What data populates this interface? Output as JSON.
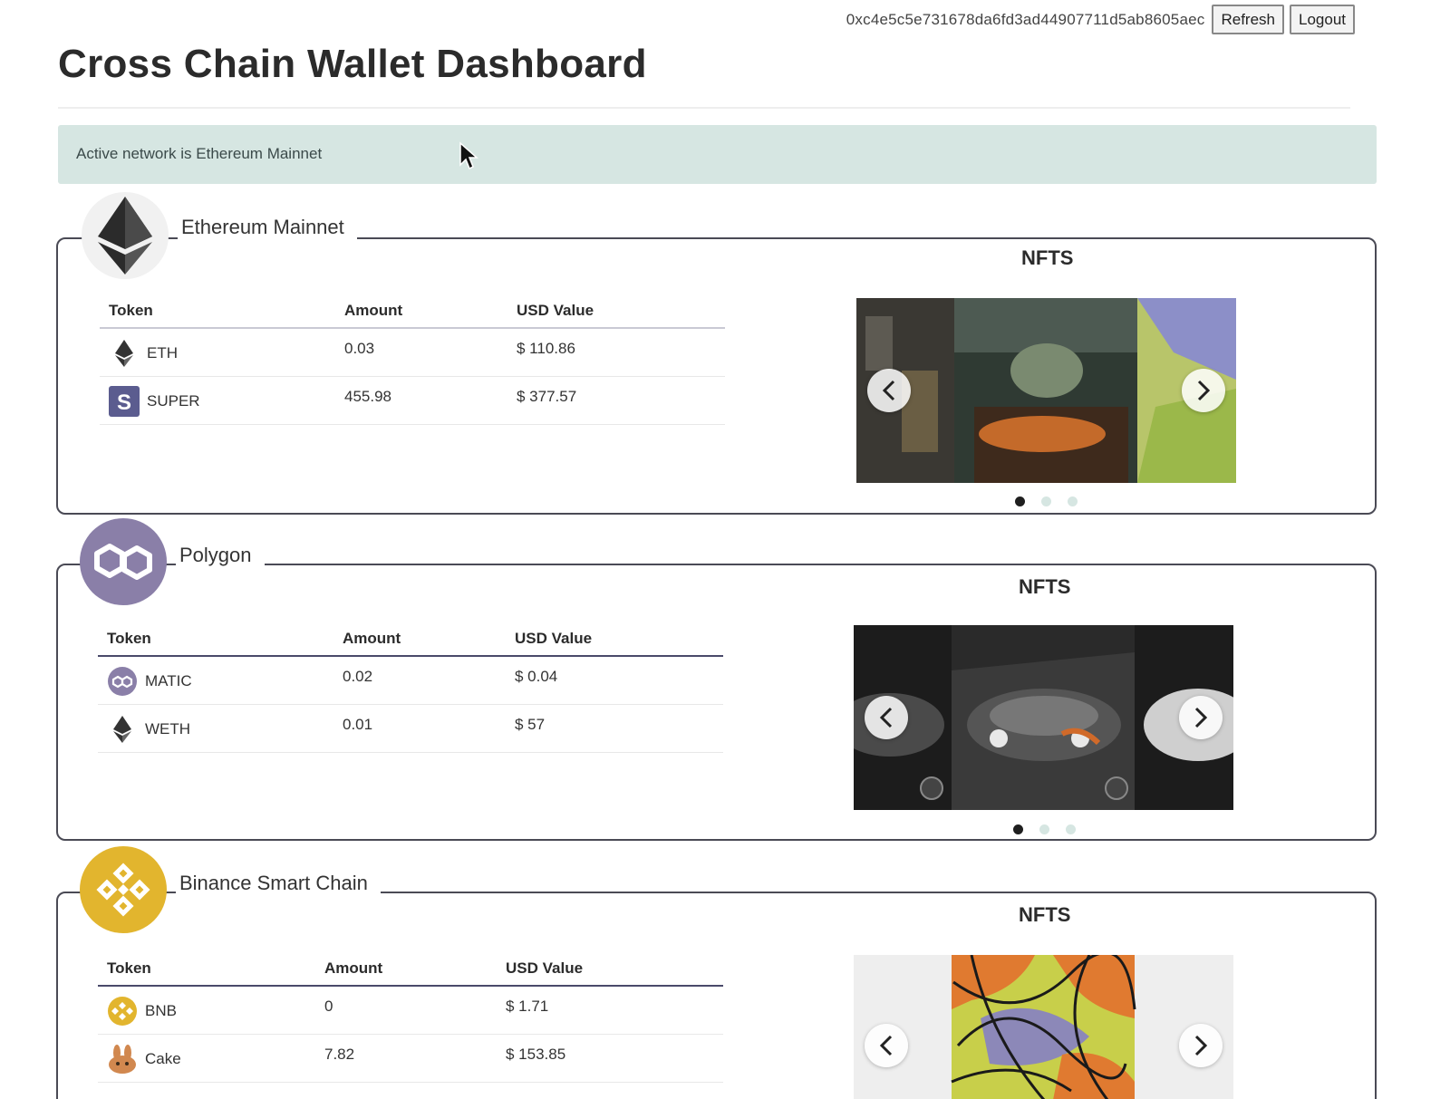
{
  "header": {
    "address": "0xc4e5c5e731678da6fd3ad44907711d5ab8605aec",
    "refresh_label": "Refresh",
    "logout_label": "Logout",
    "title": "Cross Chain Wallet Dashboard"
  },
  "alert": {
    "text": "Active network is Ethereum Mainnet"
  },
  "columns": {
    "token": "Token",
    "amount": "Amount",
    "usd": "USD Value"
  },
  "nfts_label": "NFTS",
  "networks": [
    {
      "name": "Ethereum Mainnet",
      "logo": "ethereum-icon",
      "tokens": [
        {
          "symbol": "ETH",
          "icon": "eth-icon",
          "amount": "0.03",
          "usd": "$ 110.86"
        },
        {
          "symbol": "SUPER",
          "icon": "super-icon",
          "amount": "455.98",
          "usd": "$ 377.57"
        }
      ],
      "nft_carousel": {
        "slides": 3,
        "active": 0
      }
    },
    {
      "name": "Polygon",
      "logo": "polygon-icon",
      "tokens": [
        {
          "symbol": "MATIC",
          "icon": "matic-icon",
          "amount": "0.02",
          "usd": "$ 0.04"
        },
        {
          "symbol": "WETH",
          "icon": "weth-icon",
          "amount": "0.01",
          "usd": "$ 57"
        }
      ],
      "nft_carousel": {
        "slides": 3,
        "active": 0
      }
    },
    {
      "name": "Binance Smart Chain",
      "logo": "binance-icon",
      "tokens": [
        {
          "symbol": "BNB",
          "icon": "bnb-icon",
          "amount": "0",
          "usd": "$ 1.71"
        },
        {
          "symbol": "Cake",
          "icon": "cake-icon",
          "amount": "7.82",
          "usd": "$ 153.85"
        }
      ],
      "nft_carousel": {
        "slides": 3,
        "active": 0
      }
    }
  ],
  "colors": {
    "alert_bg": "#d6e6e2",
    "polygon": "#8a7fa8",
    "binance": "#e2b52e",
    "frame": "#4a4a55"
  }
}
